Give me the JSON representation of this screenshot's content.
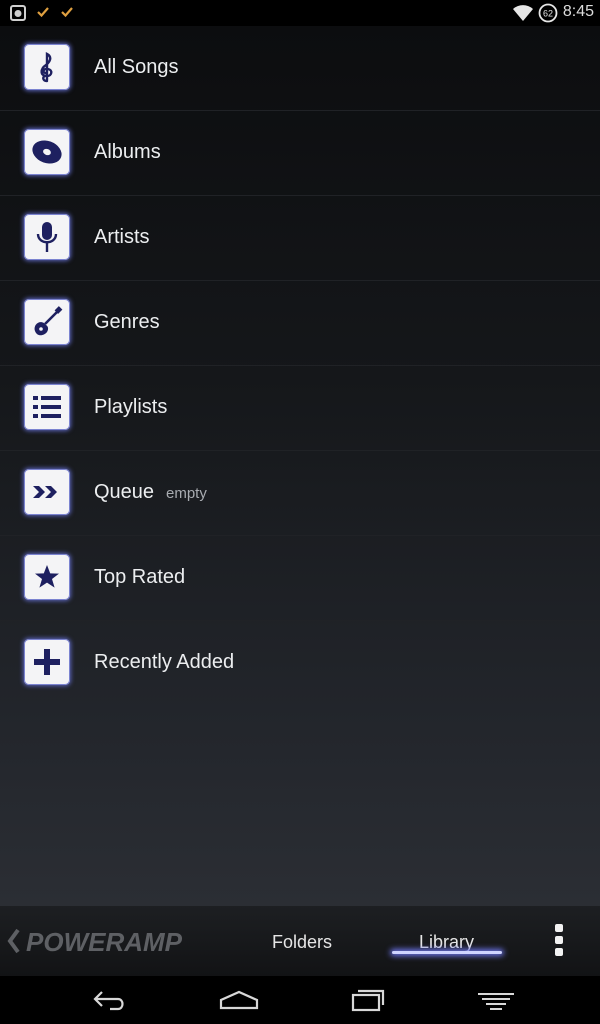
{
  "status_bar": {
    "time": "8:45",
    "battery_level": "62",
    "icons": [
      "screenshot-icon",
      "check-icon",
      "check-icon",
      "wifi-icon",
      "battery-icon"
    ]
  },
  "library": {
    "items": [
      {
        "label": "All Songs",
        "icon": "treble-clef-icon"
      },
      {
        "label": "Albums",
        "icon": "album-disc-icon"
      },
      {
        "label": "Artists",
        "icon": "microphone-icon"
      },
      {
        "label": "Genres",
        "icon": "guitar-icon"
      },
      {
        "label": "Playlists",
        "icon": "list-icon"
      },
      {
        "label": "Queue",
        "icon": "queue-arrows-icon",
        "sublabel": "empty"
      },
      {
        "label": "Top Rated",
        "icon": "star-icon"
      },
      {
        "label": "Recently Added",
        "icon": "plus-icon"
      }
    ]
  },
  "tab_bar": {
    "logo_text": "POWERAMP",
    "tabs": [
      {
        "label": "Folders",
        "active": false
      },
      {
        "label": "Library",
        "active": true
      }
    ]
  },
  "colors": {
    "accent_glow": "#6c74e8",
    "icon_glyph": "#1e2060",
    "background_top": "#0c0d0f",
    "background_bottom": "#2b2e34"
  },
  "nav_bar": {
    "buttons": [
      "back-icon",
      "home-icon",
      "recent-apps-icon",
      "menu-icon"
    ]
  }
}
